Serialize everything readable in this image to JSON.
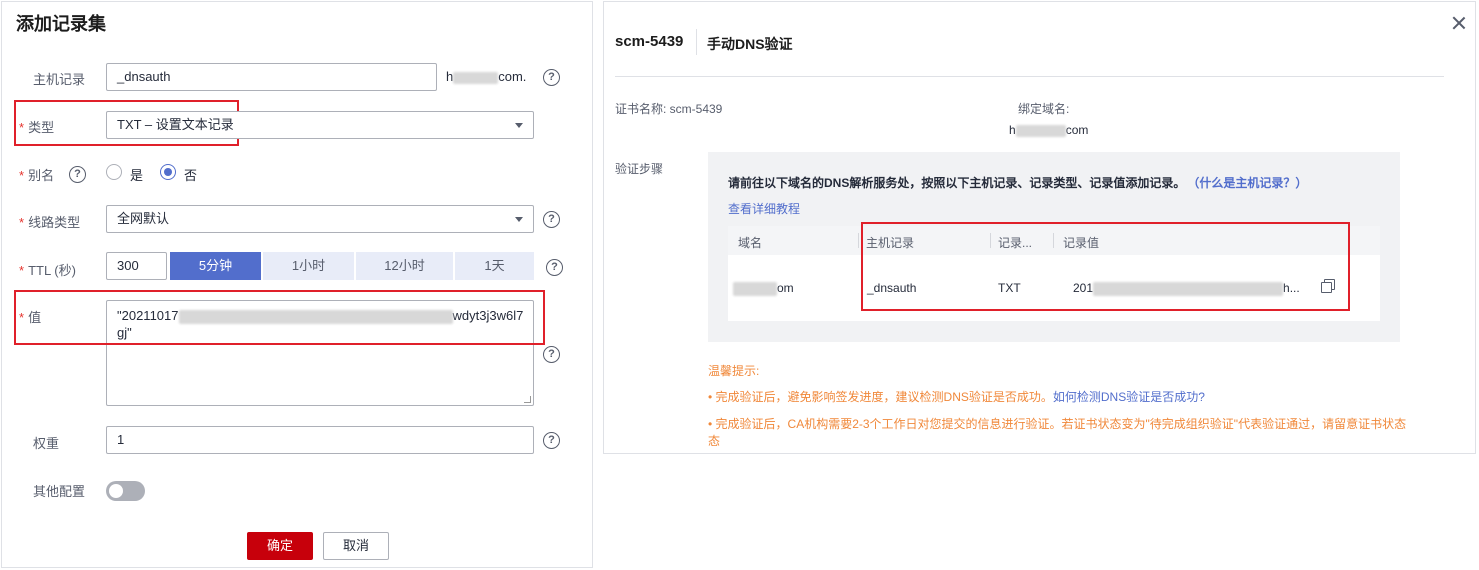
{
  "left": {
    "title": "添加记录集",
    "host_label": "主机记录",
    "host_value": "_dnsauth",
    "host_suffix_start": "h",
    "host_suffix_end": "com.",
    "type_label": "类型",
    "type_value": "TXT – 设置文本记录",
    "alias_label": "别名",
    "alias_yes": "是",
    "alias_no": "否",
    "route_label": "线路类型",
    "route_value": "全网默认",
    "ttl_label": "TTL (秒)",
    "ttl_value": "300",
    "ttl_options": [
      "5分钟",
      "1小时",
      "12小时",
      "1天"
    ],
    "value_label": "值",
    "value_line1_start": "\"20211017",
    "value_line1_end": "wdyt3j3w6l7",
    "value_line2": "gj\"",
    "weight_label": "权重",
    "weight_value": "1",
    "other_label": "其他配置",
    "confirm": "确定",
    "cancel": "取消",
    "help_glyph": "?",
    "required_mark": "*"
  },
  "right": {
    "title": "scm-5439",
    "subtitle": "手动DNS验证",
    "cert_name": "证书名称: scm-5439",
    "bind_domain_label": "绑定域名:",
    "bind_domain_start": "h",
    "bind_domain_end": "com",
    "steps_label": "验证步骤",
    "instruction": "请前往以下域名的DNS解析服务处，按照以下主机记录、记录类型、记录值添加记录。",
    "what_is_host": "（什么是主机记录？）",
    "tutorial_link": "查看详细教程",
    "table": {
      "headers": [
        "域名",
        "主机记录",
        "记录...",
        "记录值"
      ],
      "row": {
        "domain_end": "om",
        "host": "_dnsauth",
        "type": "TXT",
        "value_start": "201",
        "value_end": "h..."
      }
    },
    "tips_title": "温馨提示:",
    "tip1": "• 完成验证后，避免影响签发进度，建议检测DNS验证是否成功。",
    "tip1_link": "如何检测DNS验证是否成功?",
    "tip2_line1": "• 完成验证后，CA机构需要2-3个工作日对您提交的信息进行验证。若证书状态变为\"待完成组织验证\"代表验证通过，请留意证书状态",
    "tip2_line2": "态"
  }
}
